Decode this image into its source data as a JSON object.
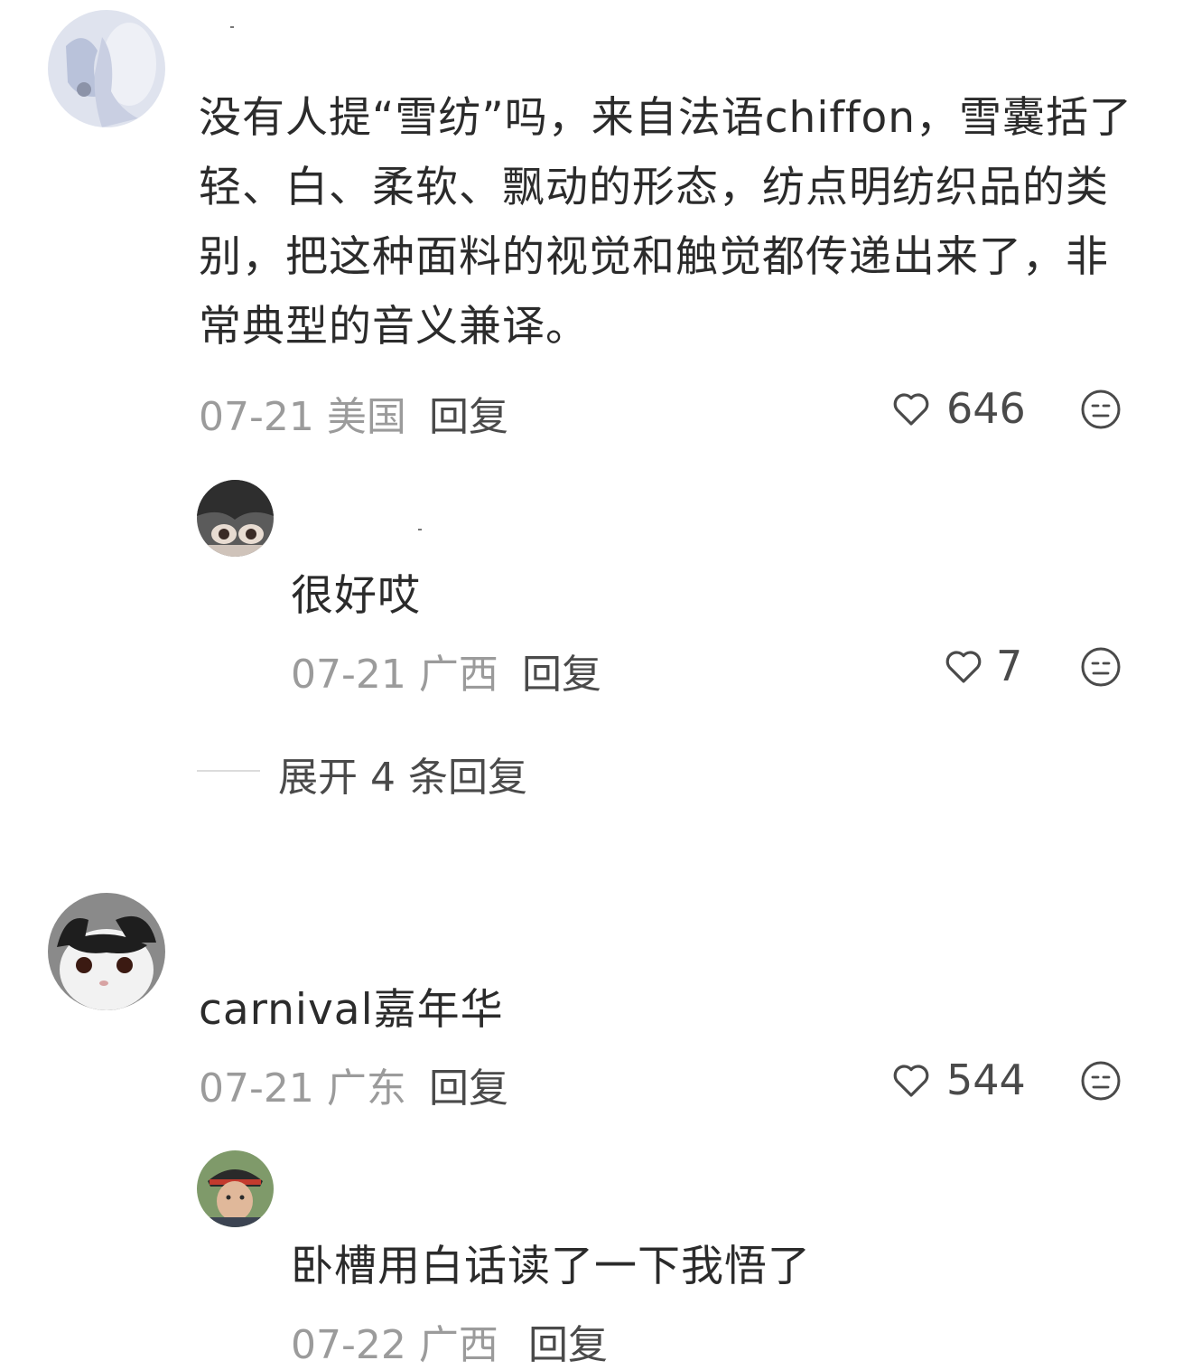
{
  "comments": [
    {
      "text": "没有人提“雪纺”吗，来自法语chiffon，雪囊括了轻、白、柔软、飘动的形态，纺点明纺织品的类别，把这种面料的视觉和触觉都传递出来了，非常典型的音义兼译。",
      "date_location": "07-21 美国",
      "reply_label": "回复",
      "likes": "646",
      "replies": [
        {
          "text": "很好哎",
          "date_location": "07-21 广西",
          "reply_label": "回复",
          "likes": "7"
        }
      ],
      "expand_label": "展开 4 条回复"
    },
    {
      "text": "carnival嘉年华",
      "date_location": "07-21 广东",
      "reply_label": "回复",
      "likes": "544",
      "replies": [
        {
          "text": "卧槽用白话读了一下我悟了",
          "date_location": "07-22 广西",
          "reply_label": "回复"
        }
      ]
    }
  ],
  "icons": {
    "like": "heart-outline-icon",
    "dislike": "meh-face-icon"
  },
  "colors": {
    "text": "#2b2b2b",
    "meta": "#9b9b9b",
    "action": "#4a4a4a",
    "divider": "#dcdcdc"
  }
}
